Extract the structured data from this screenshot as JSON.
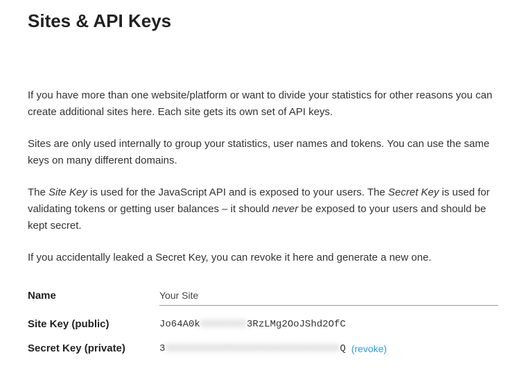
{
  "title": "Sites & API Keys",
  "paragraphs": {
    "p1": "If you have more than one website/platform or want to divide your statistics for other reasons you can create additional sites here. Each site gets its own set of API keys.",
    "p2": "Sites are only used internally to group your statistics, user names and tokens. You can use the same keys on many different domains.",
    "p3_part1": "The ",
    "p3_em1": "Site Key",
    "p3_part2": " is used for the JavaScript API and is exposed to your users. The ",
    "p3_em2": "Secret Key",
    "p3_part3": " is used for validating tokens or getting user balances – it should ",
    "p3_em3": "never",
    "p3_part4": " be exposed to your users and should be kept secret.",
    "p4": "If you accidentally leaked a Secret Key, you can revoke it here and generate a new one."
  },
  "form": {
    "name_label": "Name",
    "name_value": "Your Site",
    "site_key_label": "Site Key (public)",
    "site_key_prefix": "Jo64A0k",
    "site_key_hidden": "XXXXXXXX",
    "site_key_suffix": "3RzLMg2OoJShd2OfC",
    "secret_key_label": "Secret Key (private)",
    "secret_key_prefix": "3",
    "secret_key_hidden": "XXXXXXXXXXXXXXXXXXXXXXXXXXXXXX",
    "secret_key_suffix": "Q",
    "revoke_label": "(revoke)"
  }
}
